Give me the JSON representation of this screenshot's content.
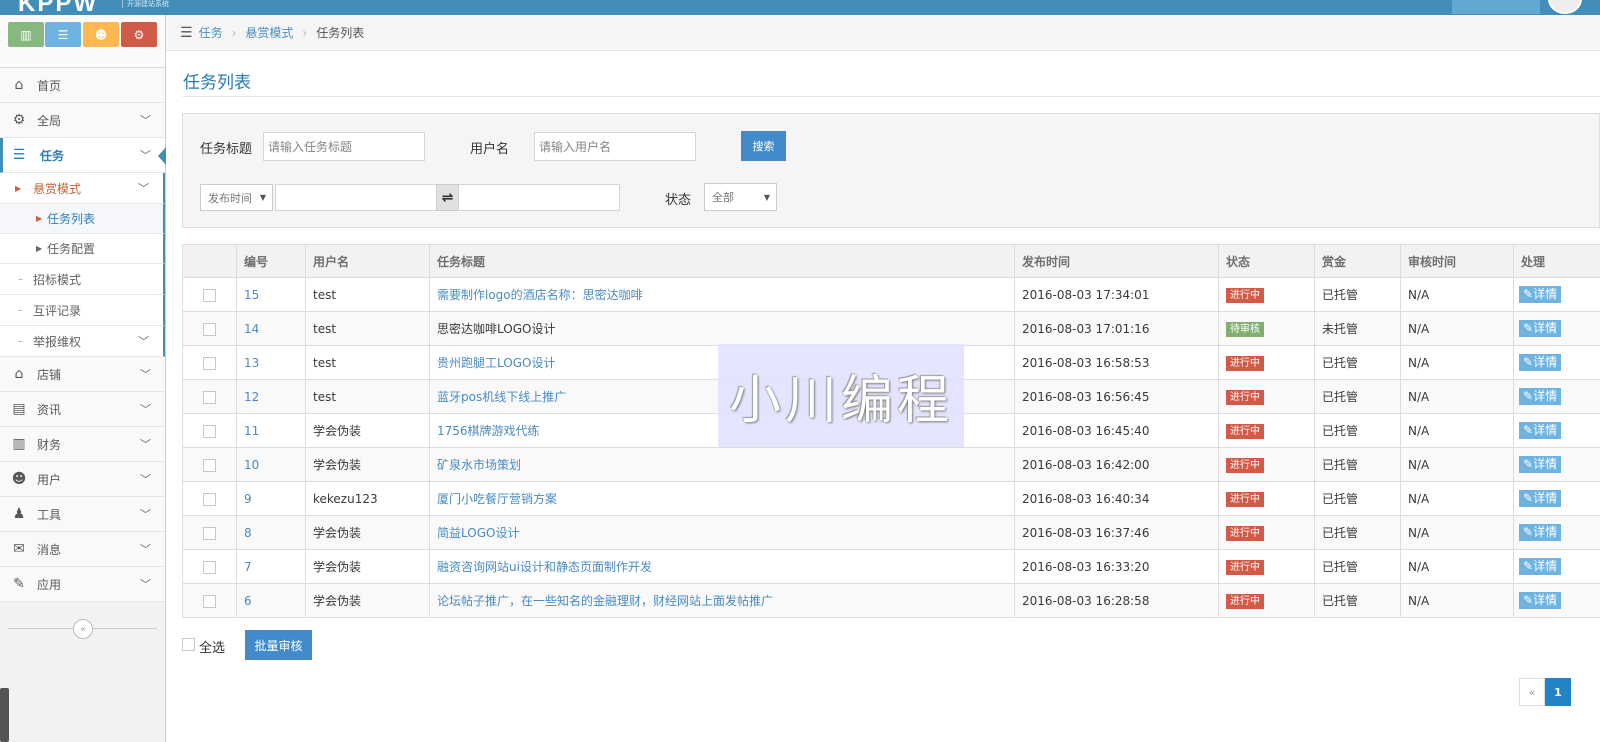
{
  "topbar": {
    "logo": "KPPW",
    "logo_sub": "开源建站系统"
  },
  "shortcuts": [
    {
      "icon": "chart-icon",
      "color": "#87b87f",
      "glyph": "▥"
    },
    {
      "icon": "list-icon",
      "color": "#6fb3e0",
      "glyph": "☰"
    },
    {
      "icon": "users-icon",
      "color": "#ffb752",
      "glyph": "☻"
    },
    {
      "icon": "settings-icon",
      "color": "#d15b47",
      "glyph": "⚙"
    }
  ],
  "sidebar": {
    "home": {
      "label": "首页",
      "icon": "home-icon",
      "glyph": "⌂"
    },
    "global": {
      "label": "全局",
      "icon": "gear-icon",
      "glyph": "⚙"
    },
    "task": {
      "label": "任务",
      "icon": "task-icon",
      "glyph": "☰"
    },
    "reward_mode": "悬赏模式",
    "task_list": "任务列表",
    "task_config": "任务配置",
    "bid_mode": "招标模式",
    "review_record": "互评记录",
    "report_rights": "举报维权",
    "shop": {
      "label": "店铺",
      "icon": "shop-icon",
      "glyph": "⌂"
    },
    "news": {
      "label": "资讯",
      "icon": "document-icon",
      "glyph": "▤"
    },
    "finance": {
      "label": "财务",
      "icon": "bar-chart-icon",
      "glyph": "▥"
    },
    "users": {
      "label": "用户",
      "icon": "users-icon",
      "glyph": "☻"
    },
    "tools": {
      "label": "工具",
      "icon": "user-icon",
      "glyph": "♟"
    },
    "messages": {
      "label": "消息",
      "icon": "envelope-icon",
      "glyph": "✉"
    },
    "apps": {
      "label": "应用",
      "icon": "edit-icon",
      "glyph": "✎"
    },
    "collapse_glyph": "«"
  },
  "breadcrumb": {
    "items": [
      "任务",
      "悬赏模式",
      "任务列表"
    ],
    "separator": "›"
  },
  "page": {
    "title": "任务列表"
  },
  "search": {
    "title_label": "任务标题",
    "title_placeholder": "请输入任务标题",
    "user_label": "用户名",
    "user_placeholder": "请输入用户名",
    "search_button": "搜索",
    "time_select": "发布时间",
    "eq_glyph": "⇌",
    "status_label": "状态",
    "status_select": "全部"
  },
  "table": {
    "headers": [
      "",
      "编号",
      "用户名",
      "任务标题",
      "发布时间",
      "状态",
      "赏金",
      "审核时间",
      "处理"
    ],
    "detail_label": "详情",
    "rows": [
      {
        "id": "15",
        "user": "test",
        "title": "需要制作logo的酒店名称：思密达咖啡",
        "title_link": true,
        "time": "2016-08-03 17:34:01",
        "status": "进行中",
        "status_color": "red",
        "reward": "已托管",
        "review": "N/A"
      },
      {
        "id": "14",
        "user": "test",
        "title": "思密达咖啡LOGO设计",
        "title_link": false,
        "time": "2016-08-03 17:01:16",
        "status": "待审核",
        "status_color": "green",
        "reward": "未托管",
        "review": "N/A"
      },
      {
        "id": "13",
        "user": "test",
        "title": "贵州跑腿工LOGO设计",
        "title_link": true,
        "time": "2016-08-03 16:58:53",
        "status": "进行中",
        "status_color": "red",
        "reward": "已托管",
        "review": "N/A"
      },
      {
        "id": "12",
        "user": "test",
        "title": "蓝牙pos机线下线上推广",
        "title_link": true,
        "time": "2016-08-03 16:56:45",
        "status": "进行中",
        "status_color": "red",
        "reward": "已托管",
        "review": "N/A"
      },
      {
        "id": "11",
        "user": "学会伪装",
        "title": "1756棋牌游戏代练",
        "title_link": true,
        "time": "2016-08-03 16:45:40",
        "status": "进行中",
        "status_color": "red",
        "reward": "已托管",
        "review": "N/A"
      },
      {
        "id": "10",
        "user": "学会伪装",
        "title": "矿泉水市场策划",
        "title_link": true,
        "time": "2016-08-03 16:42:00",
        "status": "进行中",
        "status_color": "red",
        "reward": "已托管",
        "review": "N/A"
      },
      {
        "id": "9",
        "user": "kekezu123",
        "title": "厦门小吃餐厅营销方案",
        "title_link": true,
        "time": "2016-08-03 16:40:34",
        "status": "进行中",
        "status_color": "red",
        "reward": "已托管",
        "review": "N/A"
      },
      {
        "id": "8",
        "user": "学会伪装",
        "title": "简益LOGO设计",
        "title_link": true,
        "time": "2016-08-03 16:37:46",
        "status": "进行中",
        "status_color": "red",
        "reward": "已托管",
        "review": "N/A"
      },
      {
        "id": "7",
        "user": "学会伪装",
        "title": "融资咨询网站ui设计和静态页面制作开发",
        "title_link": true,
        "time": "2016-08-03 16:33:20",
        "status": "进行中",
        "status_color": "red",
        "reward": "已托管",
        "review": "N/A"
      },
      {
        "id": "6",
        "user": "学会伪装",
        "title": "论坛帖子推广，在一些知名的金融理财，财经网站上面发帖推广",
        "title_link": true,
        "time": "2016-08-03 16:28:58",
        "status": "进行中",
        "status_color": "red",
        "reward": "已托管",
        "review": "N/A"
      }
    ]
  },
  "footer": {
    "select_all": "全选",
    "batch_review": "批量审核"
  },
  "pagination": {
    "prev": "«",
    "current": "1"
  },
  "watermark": "小川编程",
  "colors": {
    "brand_blue": "#438eb9",
    "link_blue": "#4a8ac2",
    "badge_red": "#d15b47",
    "badge_green": "#82af6f",
    "button_blue": "#428bca"
  }
}
